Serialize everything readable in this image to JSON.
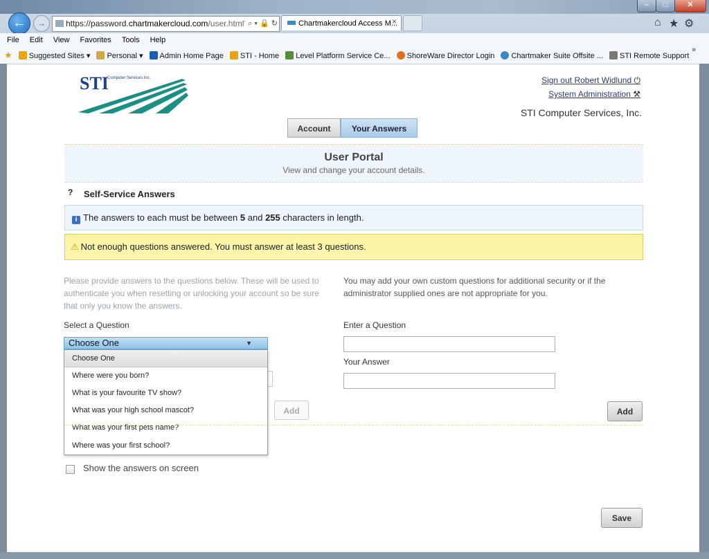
{
  "browser": {
    "window_controls": {
      "minimize": "–",
      "maximize": "□",
      "close": "✕"
    },
    "back_icon": "←",
    "forward_icon": "→",
    "address": {
      "prefix": "https://password.",
      "host": "chartmakercloud.com",
      "path": "/user.html?",
      "tools": "⌕ ▾ 🔒 ↻"
    },
    "tab_title": "Chartmakercloud Access M...",
    "tab_close": "×",
    "toolbar_icons": {
      "home": "⌂",
      "favorites": "★",
      "tools": "⚙"
    },
    "menu": [
      "File",
      "Edit",
      "View",
      "Favorites",
      "Tools",
      "Help"
    ],
    "favorites": [
      {
        "label": "Suggested Sites ▾",
        "color": "#e8a317"
      },
      {
        "label": "Personal ▾",
        "color": "#d4a84a"
      },
      {
        "label": "Admin Home Page",
        "color": "#1f5fb0"
      },
      {
        "label": "STI - Home",
        "color": "#e8a317"
      },
      {
        "label": "Level Platform Service Ce...",
        "color": "#5a8a3c"
      },
      {
        "label": "ShoreWare Director Login",
        "color": "#e07020"
      },
      {
        "label": "Chartmaker Suite Offsite ...",
        "color": "#3a8ac4"
      },
      {
        "label": "STI Remote Support",
        "color": "#777777"
      }
    ],
    "favbar_overflow": "»"
  },
  "header": {
    "logo_text": "STI",
    "logo_sub": "Computer Services Inc.",
    "signout": "Sign out Robert Widlund",
    "signout_icon": "⏻",
    "sysadmin": "System Administration",
    "sysadmin_icon": "⚒",
    "company": "STI Computer Services, Inc."
  },
  "tabs": {
    "account": "Account",
    "answers": "Your Answers"
  },
  "portal": {
    "title": "User Portal",
    "subtitle": "View and change your account details."
  },
  "section": {
    "help": "?",
    "title": "Self-Service Answers"
  },
  "info": {
    "icon": "i",
    "pre": "The answers to each must be between ",
    "min": "5",
    "mid": " and ",
    "max": "255",
    "post": " characters in length."
  },
  "warning": {
    "icon": "⚠",
    "text": "Not enough questions answered. You must answer at least 3 questions."
  },
  "left": {
    "help": "Please provide answers to the questions below. These will be used to authenticate you when resetting or unlocking your account so be sure that only you know the answers.",
    "select_label": "Select a Question",
    "select_value": "Choose One",
    "select_arrow": "▼",
    "options": [
      "Choose One",
      "Where were you born?",
      "What is your favourite TV show?",
      "What was your high school mascot?",
      "What was your first pets name?",
      "Where was your first school?"
    ],
    "add_label": "Add"
  },
  "right": {
    "help": "You may add your own custom questions for additional security or if the administrator supplied ones are not appropriate for you.",
    "question_label": "Enter a Question",
    "answer_label": "Your Answer",
    "add_label": "Add"
  },
  "show_answers_label": "Show the answers on screen",
  "save_label": "Save"
}
